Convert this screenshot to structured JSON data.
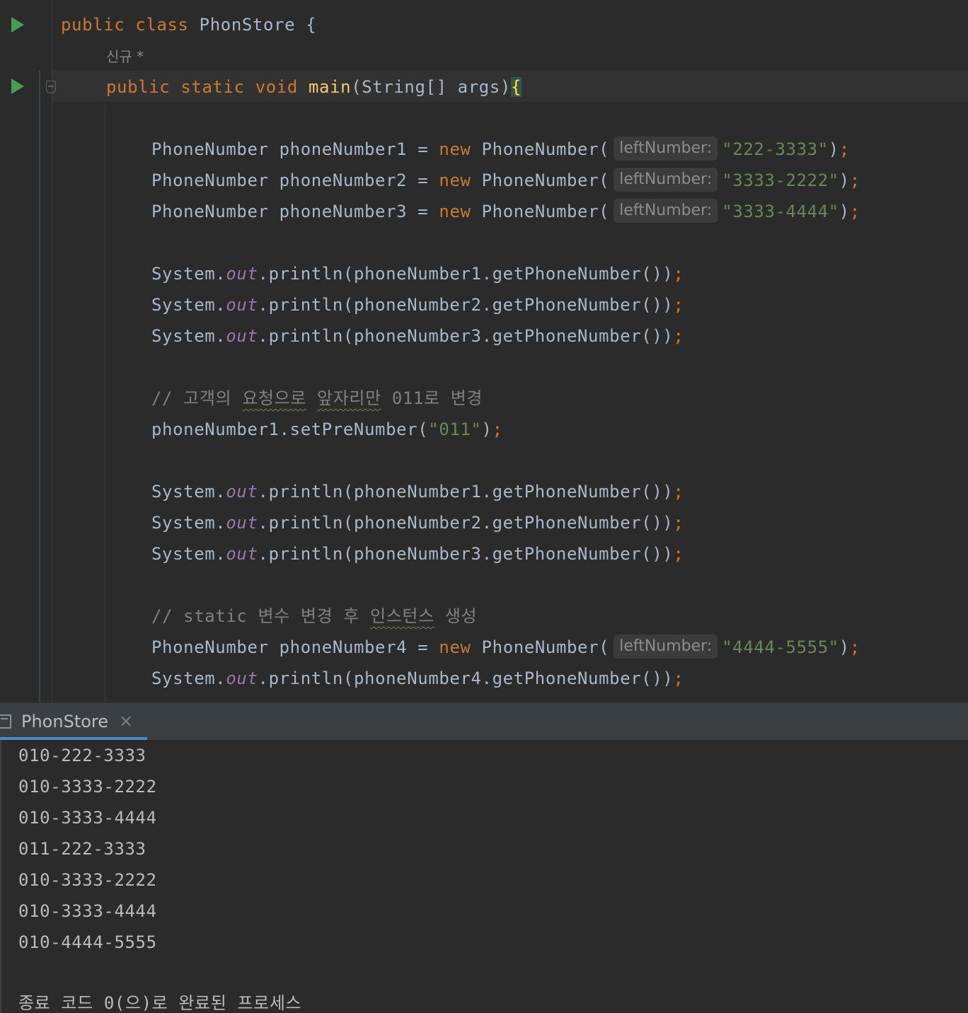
{
  "editor": {
    "class_decl": {
      "kw1": "public",
      "kw2": "class",
      "name": "PhonStore",
      "brace": "{"
    },
    "codevision_label": "신규 *",
    "main_decl": {
      "kw1": "public",
      "kw2": "static",
      "kw3": "void",
      "method": "main",
      "params": "(String[] args)",
      "brace": "{"
    },
    "hint_label": "leftNumber:",
    "ctor_lines": [
      {
        "type": "PhoneNumber",
        "var": "phoneNumber1",
        "eq": "=",
        "new_kw": "new",
        "ctor": "PhoneNumber(",
        "arg": "\"222-3333\"",
        "close": ")",
        "semi": ";"
      },
      {
        "type": "PhoneNumber",
        "var": "phoneNumber2",
        "eq": "=",
        "new_kw": "new",
        "ctor": "PhoneNumber(",
        "arg": "\"3333-2222\"",
        "close": ")",
        "semi": ";"
      },
      {
        "type": "PhoneNumber",
        "var": "phoneNumber3",
        "eq": "=",
        "new_kw": "new",
        "ctor": "PhoneNumber(",
        "arg": "\"3333-4444\"",
        "close": ")",
        "semi": ";"
      }
    ],
    "print": {
      "sys": "System.",
      "out": "out",
      "println": ".println(",
      "tail": ".getPhoneNumber())",
      "semi": ";"
    },
    "print_vars_1": [
      "phoneNumber1",
      "phoneNumber2",
      "phoneNumber3"
    ],
    "comment1": {
      "prefix": "// 고객의 ",
      "sq1": "요청으로",
      "mid": " ",
      "sq2": "앞자리만",
      "suffix": " 011로 변경"
    },
    "set_line": {
      "call": "phoneNumber1.setPreNumber(",
      "arg": "\"011\"",
      "close": ")",
      "semi": ";"
    },
    "print_vars_2": [
      "phoneNumber1",
      "phoneNumber2",
      "phoneNumber3"
    ],
    "comment2": {
      "prefix": "// static 변수 변경 후 ",
      "sq": "인스턴스",
      "suffix": " 생성"
    },
    "ctor_line4": {
      "type": "PhoneNumber",
      "var": "phoneNumber4",
      "eq": "=",
      "new_kw": "new",
      "ctor": "PhoneNumber(",
      "arg": "\"4444-5555\"",
      "close": ")",
      "semi": ";"
    },
    "print_var_4": "phoneNumber4"
  },
  "run_panel": {
    "tab_label": "PhonStore",
    "tab_close": "×",
    "output": [
      "010-222-3333",
      "010-3333-2222",
      "010-3333-4444",
      "011-222-3333",
      "010-3333-2222",
      "010-3333-4444",
      "010-4444-5555",
      "",
      "종료 코드 0(으)로 완료된 프로세스"
    ]
  },
  "colors": {
    "background": "#2b2b2b",
    "keyword": "#cc7832",
    "string": "#6a8759",
    "static_field": "#9876aa",
    "comment": "#808080",
    "method_decl": "#ffc66d",
    "run_icon": "#499c54",
    "tab_underline": "#4a88c7"
  }
}
